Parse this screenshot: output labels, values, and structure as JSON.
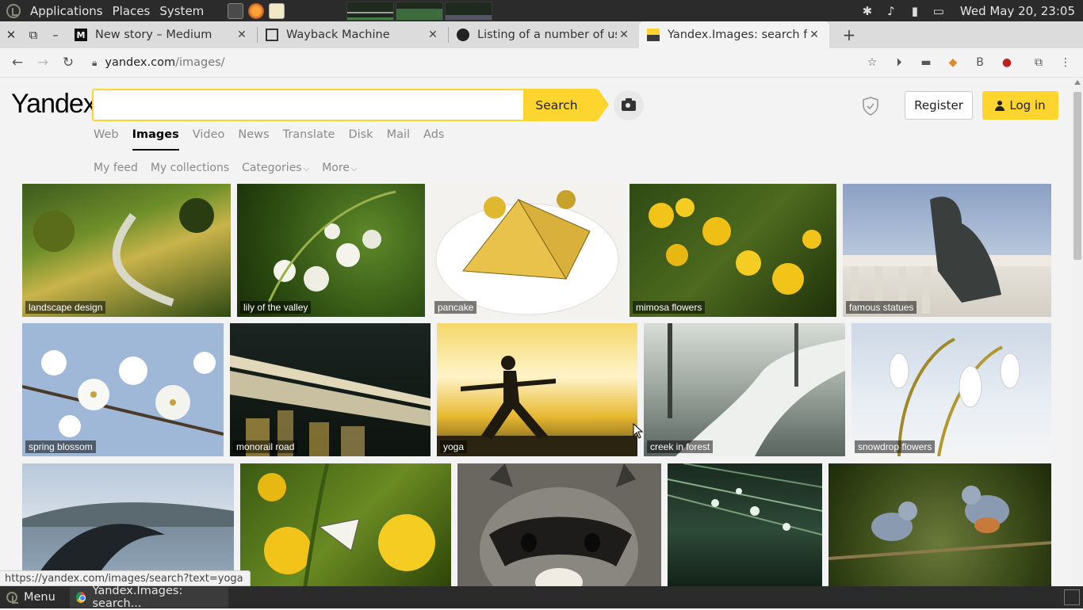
{
  "os_panel": {
    "menus": [
      "Applications",
      "Places",
      "System"
    ],
    "clock": "Wed May 20, 23:05"
  },
  "browser": {
    "tabs": [
      {
        "title": "New story – Medium",
        "favicon": "M",
        "active": false
      },
      {
        "title": "Wayback Machine",
        "favicon": "archive-icon",
        "active": false
      },
      {
        "title": "Listing of a number of useful",
        "favicon": "github-icon",
        "active": false
      },
      {
        "title": "Yandex.Images: search for",
        "favicon": "image-icon",
        "active": true
      }
    ],
    "url_host": "yandex.com",
    "url_path": "/images/"
  },
  "page": {
    "logo": "Yandex",
    "search": {
      "value": "",
      "button": "Search"
    },
    "register": "Register",
    "login": "Log in",
    "services": [
      "Web",
      "Images",
      "Video",
      "News",
      "Translate",
      "Disk",
      "Mail",
      "Ads"
    ],
    "active_service": "Images",
    "subnav": [
      "My feed",
      "My collections",
      "Categories",
      "More"
    ],
    "images": [
      {
        "label": "landscape design"
      },
      {
        "label": "lily of the valley"
      },
      {
        "label": "pancake"
      },
      {
        "label": "mimosa flowers"
      },
      {
        "label": "famous statues"
      },
      {
        "label": "spring blossom"
      },
      {
        "label": "monorail road"
      },
      {
        "label": "yoga"
      },
      {
        "label": "creek in forest"
      },
      {
        "label": "snowdrop flowers"
      },
      {
        "label": ""
      },
      {
        "label": ""
      },
      {
        "label": ""
      },
      {
        "label": ""
      },
      {
        "label": ""
      }
    ],
    "status_url": "https://yandex.com/images/search?text=yoga"
  },
  "taskbar": {
    "menu": "Menu",
    "window": "Yandex.Images: search..."
  },
  "colors": {
    "accent": "#fed52e"
  }
}
